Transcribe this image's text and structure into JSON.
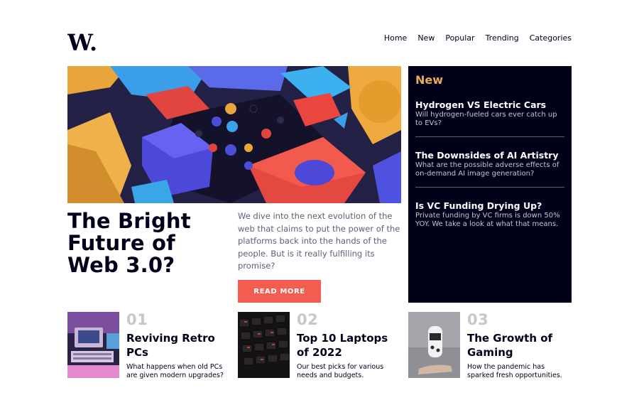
{
  "brand": {
    "logo_text": "W.",
    "colors": {
      "accent": "#f15e50",
      "dark": "#00001a",
      "orange": "#e9ab53",
      "grey": "#5d5f79"
    }
  },
  "nav": {
    "items": [
      "Home",
      "New",
      "Popular",
      "Trending",
      "Categories"
    ]
  },
  "hero": {
    "image_icon": "colorful-3d-blocks-image",
    "title": "The Bright Future of Web 3.0?",
    "description": "We dive into the next evolution of the web that claims to put the power of the platforms back into the hands of the people. But is it really fulfilling its promise?",
    "button_label": "READ MORE"
  },
  "new_panel": {
    "title": "New",
    "items": [
      {
        "title": "Hydrogen VS Electric Cars",
        "summary": "Will hydrogen-fueled cars ever catch up to EVs?"
      },
      {
        "title": "The Downsides of AI Artistry",
        "summary": "What are the possible adverse effects of on-demand AI image generation?"
      },
      {
        "title": "Is VC Funding Drying Up?",
        "summary": "Private funding by VC firms is down 50% YOY. We take a look at what that means."
      }
    ]
  },
  "cards": [
    {
      "number": "01",
      "title": "Reviving Retro PCs",
      "description": "What happens when old PCs are given modern upgrades?",
      "image_icon": "retro-pc-image"
    },
    {
      "number": "02",
      "title": "Top 10 Laptops of 2022",
      "description": "Our best picks for various needs and budgets.",
      "image_icon": "laptop-keyboard-image"
    },
    {
      "number": "03",
      "title": "The Growth of Gaming",
      "description": "How the pandemic has sparked fresh opportunities.",
      "image_icon": "game-controller-image"
    }
  ]
}
